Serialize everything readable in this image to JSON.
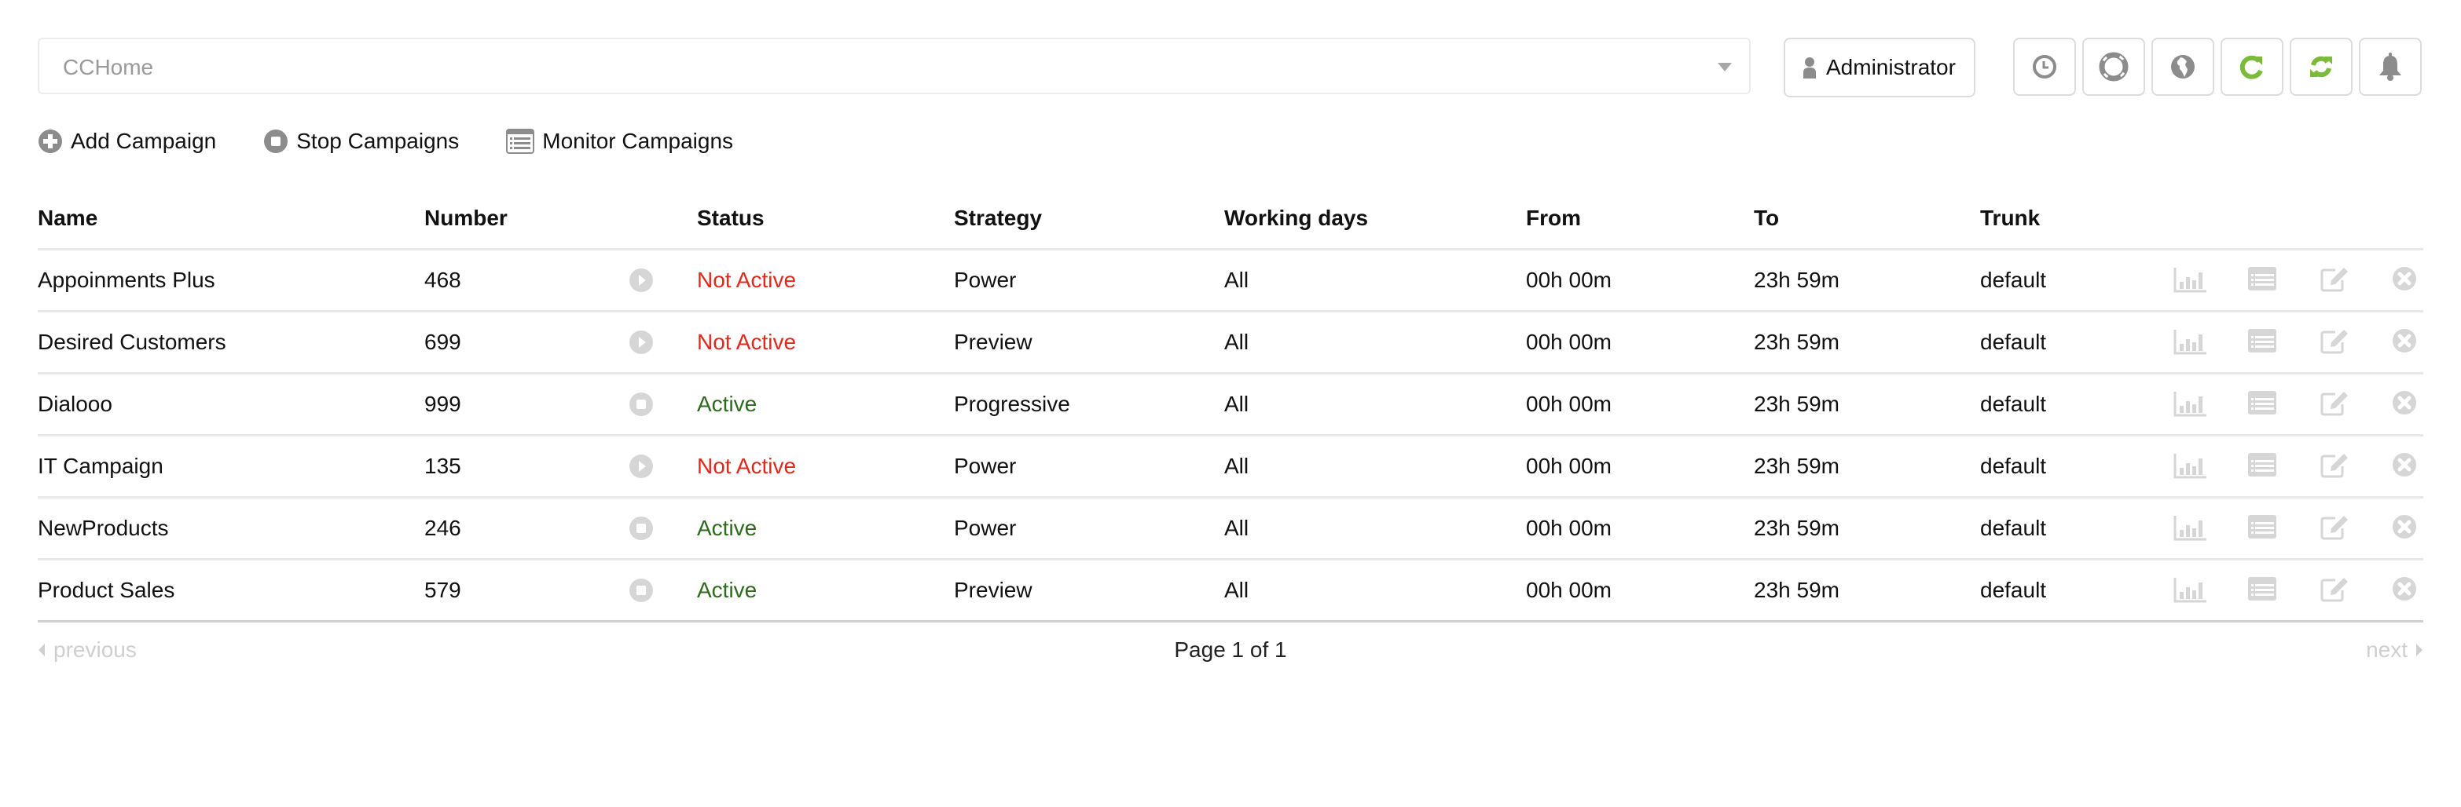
{
  "header": {
    "tenant_select": {
      "value": "CCHome"
    },
    "user_button": {
      "label": "Administrator",
      "icon": "user-icon"
    },
    "icon_buttons": [
      {
        "name": "history-button",
        "icon": "clock-icon"
      },
      {
        "name": "support-button",
        "icon": "life-ring-icon"
      },
      {
        "name": "language-button",
        "icon": "globe-icon"
      },
      {
        "name": "reload-button",
        "icon": "refresh-icon"
      },
      {
        "name": "sync-button",
        "icon": "sync-icon"
      },
      {
        "name": "notifications-button",
        "icon": "bell-icon"
      }
    ]
  },
  "toolbar": {
    "add_campaign": "Add Campaign",
    "stop_campaigns": "Stop Campaigns",
    "monitor_campaigns": "Monitor Campaigns"
  },
  "table": {
    "columns": [
      "Name",
      "Number",
      "Status",
      "Strategy",
      "Working days",
      "From",
      "To",
      "Trunk"
    ],
    "rows": [
      {
        "name": "Appoinments Plus",
        "number": "468",
        "toggle": "start",
        "status": "Not Active",
        "active": false,
        "strategy": "Power",
        "working_days": "All",
        "from": "00h 00m",
        "to": "23h 59m",
        "trunk": "default"
      },
      {
        "name": "Desired Customers",
        "number": "699",
        "toggle": "start",
        "status": "Not Active",
        "active": false,
        "strategy": "Preview",
        "working_days": "All",
        "from": "00h 00m",
        "to": "23h 59m",
        "trunk": "default"
      },
      {
        "name": "Dialooo",
        "number": "999",
        "toggle": "stop",
        "status": "Active",
        "active": true,
        "strategy": "Progressive",
        "working_days": "All",
        "from": "00h 00m",
        "to": "23h 59m",
        "trunk": "default"
      },
      {
        "name": "IT Campaign",
        "number": "135",
        "toggle": "start",
        "status": "Not Active",
        "active": false,
        "strategy": "Power",
        "working_days": "All",
        "from": "00h 00m",
        "to": "23h 59m",
        "trunk": "default"
      },
      {
        "name": "NewProducts",
        "number": "246",
        "toggle": "stop",
        "status": "Active",
        "active": true,
        "strategy": "Power",
        "working_days": "All",
        "from": "00h 00m",
        "to": "23h 59m",
        "trunk": "default"
      },
      {
        "name": "Product Sales",
        "number": "579",
        "toggle": "stop",
        "status": "Active",
        "active": true,
        "strategy": "Preview",
        "working_days": "All",
        "from": "00h 00m",
        "to": "23h 59m",
        "trunk": "default"
      }
    ],
    "row_actions": [
      "stats-icon",
      "list-icon",
      "edit-icon",
      "delete-icon"
    ]
  },
  "pager": {
    "previous": "previous",
    "next": "next",
    "page_info": "Page 1 of 1"
  },
  "colors": {
    "active": "#2d6a1e",
    "inactive": "#e2281c",
    "accent_green": "#7cbb3a",
    "icon_gray": "#8c8c8c",
    "disabled": "#d6d6d6"
  }
}
